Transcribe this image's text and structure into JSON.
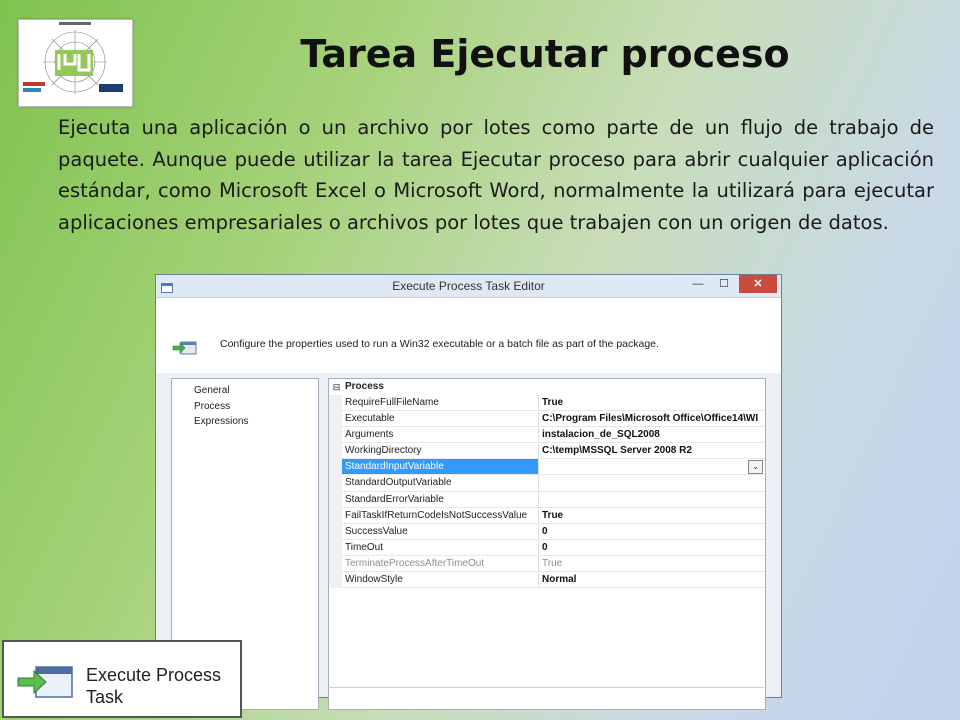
{
  "slide": {
    "title": "Tarea Ejecutar proceso",
    "paragraph": "Ejecuta una aplicación o un archivo por lotes como parte de un flujo de trabajo de paquete. Aunque puede utilizar la tarea Ejecutar proceso para abrir cualquier aplicación estándar, como Microsoft Excel o Microsoft Word, normalmente la utilizará para ejecutar aplicaciones empresariales o archivos por lotes que trabajen con un origen de datos."
  },
  "dialog": {
    "title": "Execute Process Task Editor",
    "minimize_glyph": "—",
    "maximize_glyph": "☐",
    "close_glyph": "✕",
    "header_text": "Configure the properties used to run a Win32 executable or a batch file as part of the package.",
    "nav_items": [
      {
        "label": "General"
      },
      {
        "label": "Process"
      },
      {
        "label": "Expressions"
      }
    ],
    "category": {
      "collapse_glyph": "⊟",
      "label": "Process"
    },
    "properties": [
      {
        "name": "RequireFullFileName",
        "value": "True"
      },
      {
        "name": "Executable",
        "value": "C:\\Program Files\\Microsoft Office\\Office14\\WI"
      },
      {
        "name": "Arguments",
        "value": "instalacion_de_SQL2008"
      },
      {
        "name": "WorkingDirectory",
        "value": "C:\\temp\\MSSQL Server 2008 R2"
      },
      {
        "name": "StandardInputVariable",
        "value": ""
      },
      {
        "name": "StandardOutputVariable",
        "value": ""
      },
      {
        "name": "StandardErrorVariable",
        "value": ""
      },
      {
        "name": "FailTaskIfReturnCodeIsNotSuccessValue",
        "value": "True"
      },
      {
        "name": "SuccessValue",
        "value": "0"
      },
      {
        "name": "TimeOut",
        "value": "0"
      },
      {
        "name": "TerminateProcessAfterTimeOut",
        "value": "True"
      },
      {
        "name": "WindowStyle",
        "value": "Normal"
      }
    ],
    "dropdown_glyph": "⌄"
  },
  "badge": {
    "line1": "Execute Process",
    "line2": "Task"
  },
  "colors": {
    "selection": "#3399ff",
    "titlebar": "#dfe9f6",
    "close": "#c94c3f"
  }
}
